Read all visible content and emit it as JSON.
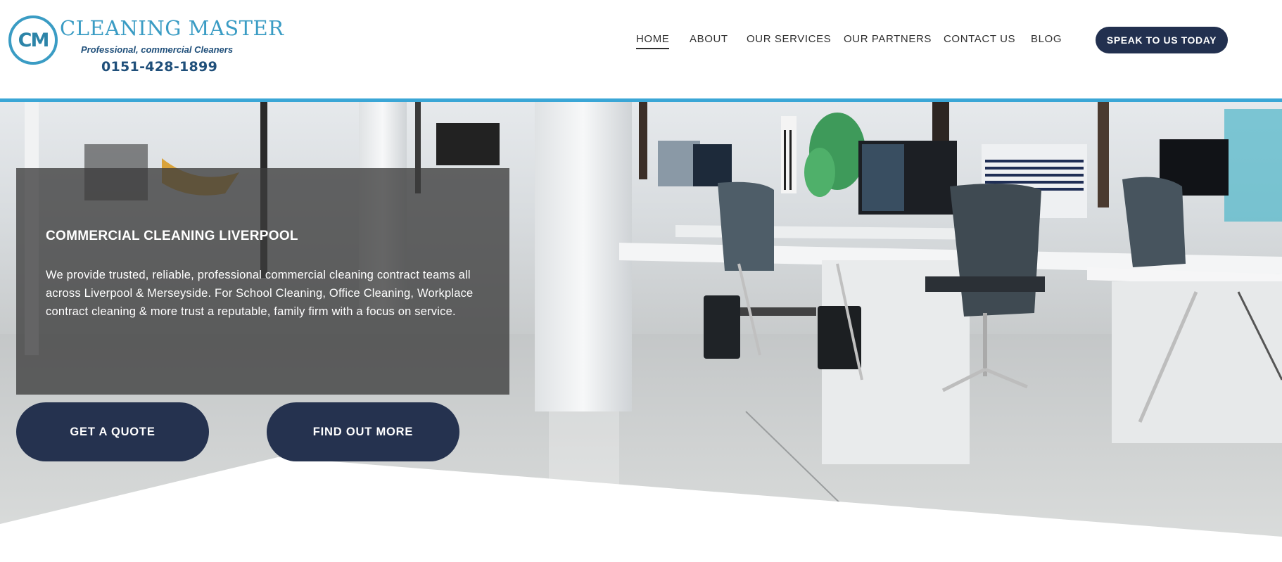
{
  "brand": {
    "monogram": "CM",
    "name": "CLEANING MASTER",
    "tagline": "Professional, commercial Cleaners",
    "phone": "0151-428-1899",
    "colors": {
      "logo_blue": "#3a9cc4",
      "logo_dark": "#1f4f7a",
      "accent_bar": "#3aa6d6",
      "button_navy": "#22304f",
      "overlay": "#3c3c3c"
    }
  },
  "nav": {
    "items": [
      {
        "label": "HOME",
        "active": true
      },
      {
        "label": "ABOUT",
        "active": false
      },
      {
        "label": "OUR SERVICES",
        "active": false
      },
      {
        "label": "OUR PARTNERS",
        "active": false
      },
      {
        "label": "CONTACT US",
        "active": false
      },
      {
        "label": "BLOG",
        "active": false
      }
    ],
    "cta_label": "SPEAK TO US TODAY"
  },
  "hero": {
    "background_image": "modern open-plan office with white desks, mesh chairs, monitors and polished floor",
    "title": "COMMERCIAL CLEANING LIVERPOOL",
    "description": "We provide trusted, reliable, professional commercial cleaning contract teams all across Liverpool & Merseyside. For School Cleaning, Office Cleaning, Workplace contract cleaning & more trust a reputable, family firm with a focus on service.",
    "buttons": [
      {
        "label": "GET A QUOTE"
      },
      {
        "label": "FIND OUT MORE"
      }
    ]
  }
}
